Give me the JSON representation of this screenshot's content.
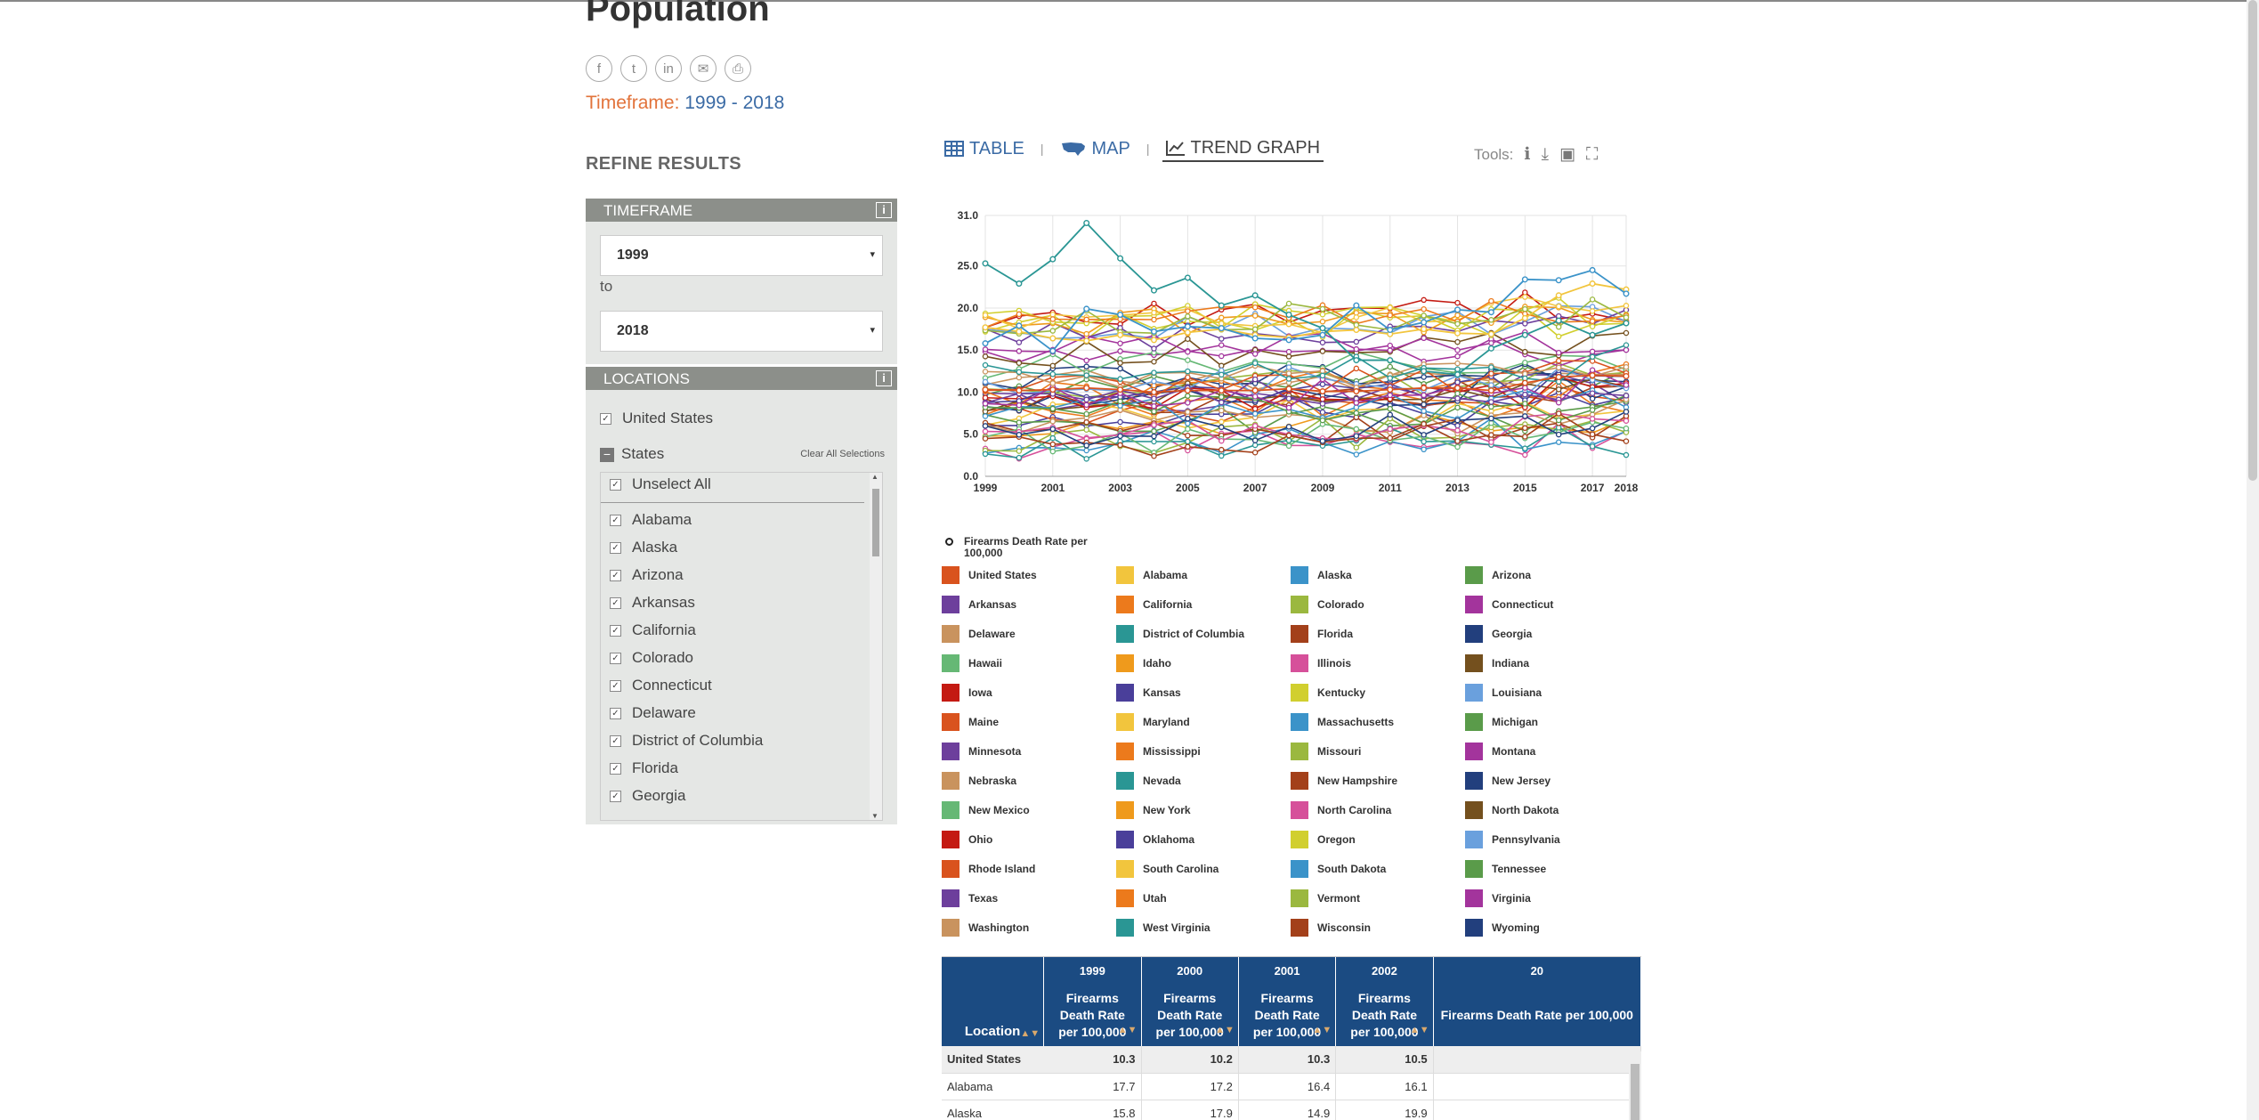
{
  "page": {
    "title": "Population",
    "timeframe_label": "Timeframe:",
    "timeframe_value": "1999 - 2018"
  },
  "share": [
    {
      "name": "facebook-icon",
      "glyph": "f"
    },
    {
      "name": "twitter-icon",
      "glyph": "t"
    },
    {
      "name": "linkedin-icon",
      "glyph": "in"
    },
    {
      "name": "email-icon",
      "glyph": "✉"
    },
    {
      "name": "print-icon",
      "glyph": "⎙"
    }
  ],
  "refine": {
    "heading": "REFINE RESULTS",
    "timeframe_head": "TIMEFRAME",
    "from": "1999",
    "to_label": "to",
    "to": "2018",
    "locations_head": "LOCATIONS",
    "us_label": "United States",
    "states_label": "States",
    "clear_label": "Clear All Selections",
    "unselect_label": "Unselect All",
    "state_list": [
      "Alabama",
      "Alaska",
      "Arizona",
      "Arkansas",
      "California",
      "Colorado",
      "Connecticut",
      "Delaware",
      "District of Columbia",
      "Florida",
      "Georgia"
    ]
  },
  "tabs": {
    "table": "TABLE",
    "map": "MAP",
    "trend": "TREND GRAPH"
  },
  "tools": {
    "label": "Tools:"
  },
  "legend": {
    "header": "Firearms Death Rate per 100,000",
    "items": [
      {
        "label": "United States",
        "color": "#d9531e"
      },
      {
        "label": "Alabama",
        "color": "#f2c53d"
      },
      {
        "label": "Alaska",
        "color": "#3b93c9"
      },
      {
        "label": "Arizona",
        "color": "#5a9b4a"
      },
      {
        "label": "Arkansas",
        "color": "#6d3f9c"
      },
      {
        "label": "California",
        "color": "#ec7a1c"
      },
      {
        "label": "Colorado",
        "color": "#9bb83f"
      },
      {
        "label": "Connecticut",
        "color": "#a3349c"
      },
      {
        "label": "Delaware",
        "color": "#c9935e"
      },
      {
        "label": "District of Columbia",
        "color": "#2a9694"
      },
      {
        "label": "Florida",
        "color": "#a3401a"
      },
      {
        "label": "Georgia",
        "color": "#223f7d"
      },
      {
        "label": "Hawaii",
        "color": "#66b875"
      },
      {
        "label": "Idaho",
        "color": "#ef9a1c"
      },
      {
        "label": "Illinois",
        "color": "#d6509a"
      },
      {
        "label": "Indiana",
        "color": "#74501e"
      },
      {
        "label": "Iowa",
        "color": "#c41a12"
      },
      {
        "label": "Kansas",
        "color": "#4a3f9a"
      },
      {
        "label": "Kentucky",
        "color": "#d1cf2f"
      },
      {
        "label": "Louisiana",
        "color": "#6aa0dd"
      },
      {
        "label": "Maine",
        "color": "#d9531e"
      },
      {
        "label": "Maryland",
        "color": "#f2c53d"
      },
      {
        "label": "Massachusetts",
        "color": "#3b93c9"
      },
      {
        "label": "Michigan",
        "color": "#5a9b4a"
      },
      {
        "label": "Minnesota",
        "color": "#6d3f9c"
      },
      {
        "label": "Mississippi",
        "color": "#ec7a1c"
      },
      {
        "label": "Missouri",
        "color": "#9bb83f"
      },
      {
        "label": "Montana",
        "color": "#a3349c"
      },
      {
        "label": "Nebraska",
        "color": "#c9935e"
      },
      {
        "label": "Nevada",
        "color": "#2a9694"
      },
      {
        "label": "New Hampshire",
        "color": "#a3401a"
      },
      {
        "label": "New Jersey",
        "color": "#223f7d"
      },
      {
        "label": "New Mexico",
        "color": "#66b875"
      },
      {
        "label": "New York",
        "color": "#ef9a1c"
      },
      {
        "label": "North Carolina",
        "color": "#d6509a"
      },
      {
        "label": "North Dakota",
        "color": "#74501e"
      },
      {
        "label": "Ohio",
        "color": "#c41a12"
      },
      {
        "label": "Oklahoma",
        "color": "#4a3f9a"
      },
      {
        "label": "Oregon",
        "color": "#d1cf2f"
      },
      {
        "label": "Pennsylvania",
        "color": "#6aa0dd"
      },
      {
        "label": "Rhode Island",
        "color": "#d9531e"
      },
      {
        "label": "South Carolina",
        "color": "#f2c53d"
      },
      {
        "label": "South Dakota",
        "color": "#3b93c9"
      },
      {
        "label": "Tennessee",
        "color": "#5a9b4a"
      },
      {
        "label": "Texas",
        "color": "#6d3f9c"
      },
      {
        "label": "Utah",
        "color": "#ec7a1c"
      },
      {
        "label": "Vermont",
        "color": "#9bb83f"
      },
      {
        "label": "Virginia",
        "color": "#a3349c"
      },
      {
        "label": "Washington",
        "color": "#c9935e"
      },
      {
        "label": "West Virginia",
        "color": "#2a9694"
      },
      {
        "label": "Wisconsin",
        "color": "#a3401a"
      },
      {
        "label": "Wyoming",
        "color": "#223f7d"
      }
    ]
  },
  "chart_data": {
    "type": "line",
    "x": [
      1999,
      2000,
      2001,
      2002,
      2003,
      2004,
      2005,
      2006,
      2007,
      2008,
      2009,
      2010,
      2011,
      2012,
      2013,
      2014,
      2015,
      2016,
      2017,
      2018
    ],
    "x_tick_labels": [
      "1999",
      "2001",
      "2003",
      "2005",
      "2007",
      "2009",
      "2011",
      "2013",
      "2015",
      "2017",
      "2018"
    ],
    "ylim": [
      0,
      31
    ],
    "y_ticks": [
      "0.0",
      "5.0",
      "10.0",
      "15.0",
      "20.0",
      "25.0",
      "31.0"
    ],
    "grid": true,
    "series": [
      {
        "name": "United States",
        "values": [
          10.3,
          10.2,
          10.3,
          10.5,
          10.3,
          10.0,
          10.2,
          10.2,
          10.2,
          10.4,
          10.1,
          10.1,
          10.3,
          10.5,
          10.5,
          10.2,
          11.1,
          11.8,
          12.0,
          11.9
        ]
      },
      {
        "name": "Alabama",
        "values": [
          17.7,
          17.2,
          16.4,
          16.1,
          16.8,
          16.2,
          17.1,
          17.5,
          16.8,
          16.5,
          17.2,
          17.4,
          16.9,
          17.5,
          17.0,
          16.9,
          18.8,
          21.5,
          22.9,
          22.2
        ]
      },
      {
        "name": "Alaska",
        "values": [
          15.8,
          17.9,
          14.9,
          19.9,
          19.2,
          17.2,
          17.8,
          17.6,
          16.4,
          16.2,
          16.8,
          20.3,
          17.4,
          18.3,
          19.8,
          19.5,
          23.4,
          23.3,
          24.5,
          21.7
        ]
      },
      {
        "name": "District of Columbia",
        "values": [
          25.3,
          22.9,
          25.8,
          30.1,
          25.9,
          22.1,
          23.6,
          20.3,
          21.5,
          19.2,
          17.6,
          13.8,
          13.8,
          12.5,
          12.1,
          15.2,
          16.8,
          18.5,
          16.8,
          18.2
        ]
      }
    ]
  },
  "table": {
    "location_header": "Location",
    "metric_header": "Firearms Death Rate per 100,000",
    "years": [
      "1999",
      "2000",
      "2001",
      "2002",
      "20"
    ],
    "rows": [
      {
        "location": "United States",
        "values": [
          "10.3",
          "10.2",
          "10.3",
          "10.5"
        ]
      },
      {
        "location": "Alabama",
        "values": [
          "17.7",
          "17.2",
          "16.4",
          "16.1"
        ]
      },
      {
        "location": "Alaska",
        "values": [
          "15.8",
          "17.9",
          "14.9",
          "19.9"
        ]
      }
    ]
  }
}
